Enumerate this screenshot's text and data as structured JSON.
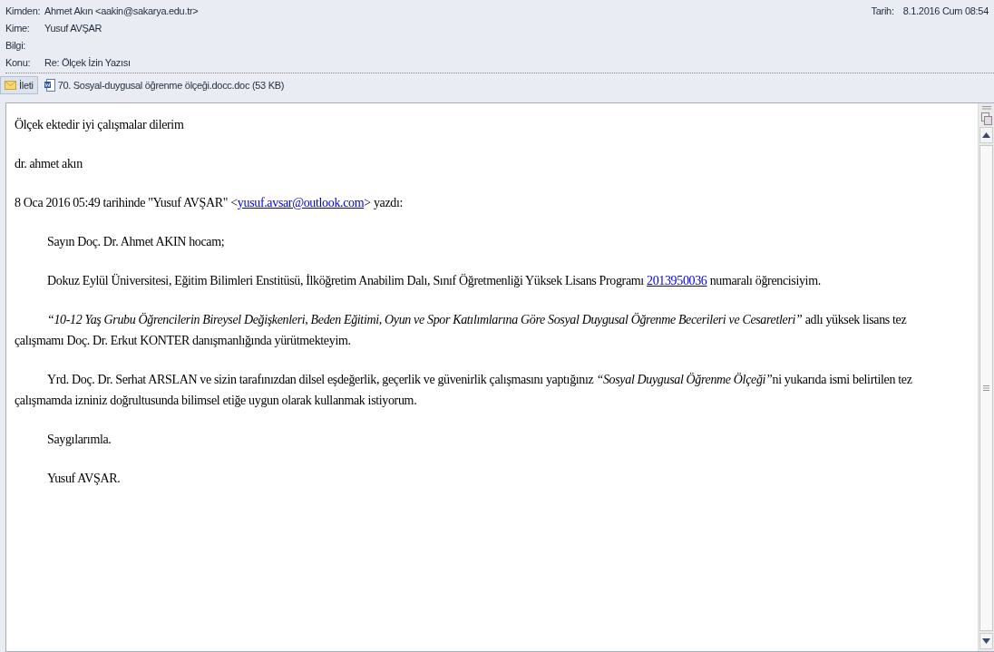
{
  "header": {
    "fields": [
      {
        "label": "Kimden:",
        "value": "Ahmet Akın <aakin@sakarya.edu.tr>"
      },
      {
        "label": "Kime:",
        "value": "Yusuf AVŞAR"
      },
      {
        "label": "Bilgi:"
      },
      {
        "label": "Konu:",
        "value": "Re: Ölçek İzin Yazısı"
      }
    ],
    "date_label": "Tarih:",
    "date": "8.1.2016 Cum 08:54"
  },
  "attachments": [
    {
      "kind": "message",
      "label": "İleti",
      "selected": true
    },
    {
      "kind": "document",
      "label": "70. Sosyal-duygusal öğrenme ölçeği.docc.doc (53 KB)",
      "selected": false
    }
  ],
  "body": [
    {
      "indent": false,
      "parts": [
        {
          "kind": "text",
          "text": "Ölçek ektedir iyi çalışmalar dilerim"
        }
      ]
    },
    {
      "indent": false,
      "parts": [
        {
          "kind": "text",
          "text": "dr. ahmet akın"
        }
      ]
    },
    {
      "indent": false,
      "parts": [
        {
          "kind": "text",
          "text": "8 Oca 2016 05:49 tarihinde \"Yusuf AVŞAR\" <"
        },
        {
          "kind": "link",
          "text": "yusuf.avsar@outlook.com"
        },
        {
          "kind": "text",
          "text": "> yazdı:"
        }
      ]
    },
    {
      "indent": true,
      "parts": [
        {
          "kind": "text",
          "text": "Sayın Doç. Dr. Ahmet AKIN hocam;"
        }
      ]
    },
    {
      "indent": true,
      "parts": [
        {
          "kind": "text",
          "text": "Dokuz Eylül Üniversitesi, Eğitim Bilimleri Enstitüsü, İlköğretim Anabilim Dalı, Sınıf Öğretmenliği Yüksek Lisans Programı "
        },
        {
          "kind": "link",
          "text": "2013950036"
        },
        {
          "kind": "text",
          "text": " numaralı öğrencisiyim."
        }
      ]
    },
    {
      "indent": true,
      "parts": [
        {
          "kind": "italic",
          "text": "“10-12 Yaş Grubu Öğrencilerin Bireysel Değişkenleri, Beden Eğitimi, Oyun ve Spor Katılımlarına Göre Sosyal Duygusal Öğrenme Becerileri ve Cesaretleri”"
        },
        {
          "kind": "text",
          "text": " adlı yüksek lisans tez çalışmamı Doç. Dr. Erkut KONTER danışmanlığında yürütmekteyim."
        }
      ]
    },
    {
      "indent": true,
      "parts": [
        {
          "kind": "text",
          "text": "Yrd. Doç. Dr. Serhat ARSLAN ve sizin tarafınızdan dilsel eşdeğerlik, geçerlik ve güvenirlik çalışmasını yaptığınız "
        },
        {
          "kind": "italic",
          "text": "“Sosyal Duygusal Öğrenme Ölçeği”"
        },
        {
          "kind": "text",
          "text": "ni yukarıda ismi belirtilen tez çalışmamda izniniz doğrultusunda bilimsel etiğe uygun olarak kullanmak istiyorum."
        }
      ]
    },
    {
      "indent": true,
      "parts": [
        {
          "kind": "text",
          "text": "Saygılarımla."
        }
      ]
    },
    {
      "indent": true,
      "parts": [
        {
          "kind": "text",
          "text": "Yusuf AVŞAR."
        }
      ]
    }
  ]
}
